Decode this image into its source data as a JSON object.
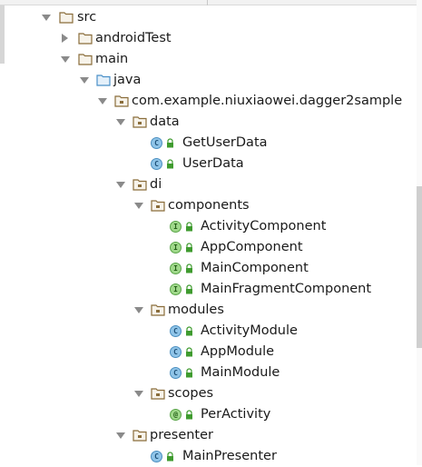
{
  "tree": {
    "src": "src",
    "android_test": "androidTest",
    "main": "main",
    "java": "java",
    "package": "com.example.niuxiaowei.dagger2sample",
    "data": "data",
    "get_user_data": "GetUserData",
    "user_data": "UserData",
    "di": "di",
    "components": "components",
    "activity_component": "ActivityComponent",
    "app_component": "AppComponent",
    "main_component": "MainComponent",
    "main_fragment_component": "MainFragmentComponent",
    "modules": "modules",
    "activity_module": "ActivityModule",
    "app_module": "AppModule",
    "main_module": "MainModule",
    "scopes": "scopes",
    "per_activity": "PerActivity",
    "presenter": "presenter",
    "main_presenter": "MainPresenter"
  },
  "badges": {
    "class": "C",
    "interface": "I",
    "annotation": "@"
  },
  "colors": {
    "folder_outline": "#8a6d3b",
    "java_folder": "#4a90c8",
    "expand_arrow": "#8a8a8a",
    "lock_green": "#3f9b2f"
  }
}
